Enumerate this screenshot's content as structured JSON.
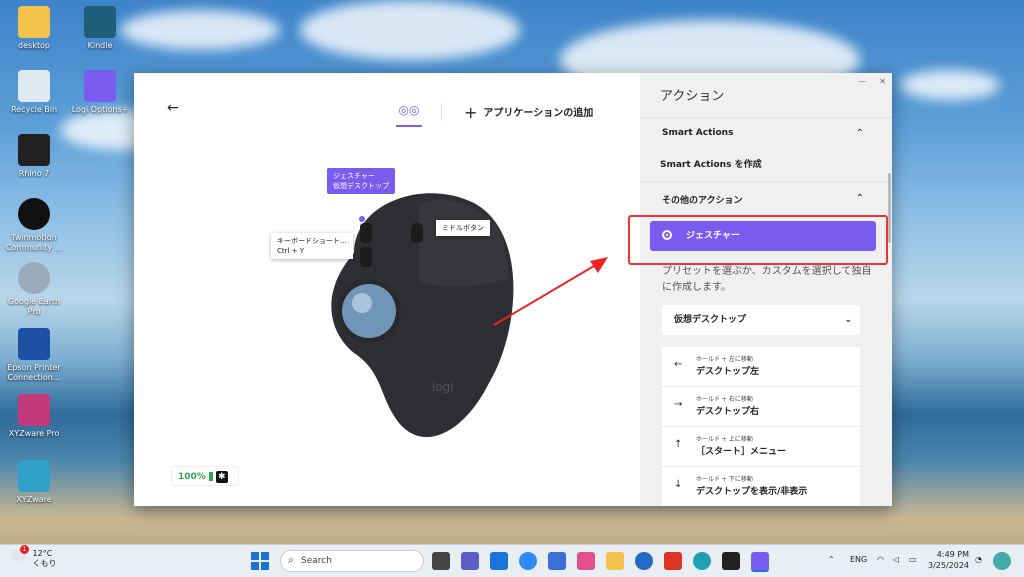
{
  "desktop": {
    "icons": [
      {
        "label": "desktop"
      },
      {
        "label": "Kindle"
      },
      {
        "label": "Recycle Bin"
      },
      {
        "label": "Logi Options+"
      },
      {
        "label": "Rhino 7"
      },
      {
        "label": "Twinmotion Community ..."
      },
      {
        "label": "Google Earth Pro"
      },
      {
        "label": "Epson Printer Connection..."
      },
      {
        "label": "XYZware Pro"
      },
      {
        "label": "XYZware"
      }
    ]
  },
  "app": {
    "add_app_label": "アプリケーションの追加",
    "callouts": {
      "gesture_line1": "ジェスチャー",
      "gesture_line2": "仮想デスクトップ",
      "keyboard_line1": "キーボードショート...",
      "keyboard_line2": "Ctrl + Y",
      "middle": "ミドルボタン"
    },
    "mouse_brand": "logi",
    "battery": "100%"
  },
  "side": {
    "title": "アクション",
    "smart_actions_header": "Smart Actions",
    "smart_actions_create": "Smart Actions を作成",
    "other_actions_header": "その他のアクション",
    "gesture_button": "ジェスチャー",
    "description": "プリセットを選ぶか、カスタムを選択して独自に作成します。",
    "preset_value": "仮想デスクトップ",
    "gestures": [
      {
        "arrow": "←",
        "small": "ホールド + 左に移動",
        "big": "デスクトップ左"
      },
      {
        "arrow": "→",
        "small": "ホールド + 右に移動",
        "big": "デスクトップ右"
      },
      {
        "arrow": "↑",
        "small": "ホールド + 上に移動",
        "big": "［スタート］メニュー"
      },
      {
        "arrow": "↓",
        "small": "ホールド + 下に移動",
        "big": "デスクトップを表示/非表示"
      }
    ]
  },
  "taskbar": {
    "weather_temp": "12°C",
    "weather_desc": "くもり",
    "notif_count": "1",
    "search_placeholder": "Search",
    "lang": "ENG",
    "time": "4:49 PM",
    "date": "3/25/2024"
  }
}
